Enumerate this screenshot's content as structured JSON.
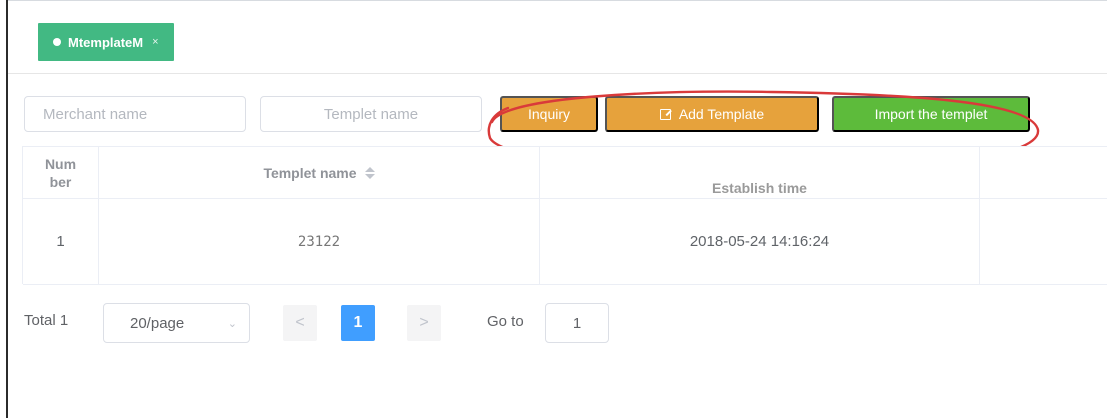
{
  "tabs": [
    {
      "label": "MtemplateM",
      "close": "×",
      "active": true
    }
  ],
  "filters": {
    "merchant_placeholder": "Merchant name",
    "templet_placeholder": "Templet name"
  },
  "buttons": {
    "inquiry": "Inquiry",
    "add_template": "Add Template",
    "import_templet": "Import the templet"
  },
  "table": {
    "headers": [
      "Num\nber",
      "Templet name",
      "Establish time",
      ""
    ],
    "rows": [
      {
        "number": "1",
        "templet_name": "23122",
        "establish_time": "2018-05-24 14:16:24",
        "actions": ""
      }
    ]
  },
  "pagination": {
    "total": "Total 1",
    "page_size": "20/page",
    "prev": "<",
    "current_page": "1",
    "next": ">",
    "goto_label": "Go to",
    "goto_value": "1"
  },
  "colors": {
    "tab_active": "#42b983",
    "warning_button": "#e6a23c",
    "success_button": "#5dbb3b",
    "current_page": "#409eff",
    "annotation_circle": "#d93a3a"
  },
  "icons": {
    "active_dot": "dot-icon",
    "close": "close-icon",
    "edit": "edit-icon",
    "sort": "sort-icon",
    "page_size_dropdown": "chevron-down-icon",
    "previous": "chevron-left-icon",
    "next": "chevron-right-icon"
  }
}
